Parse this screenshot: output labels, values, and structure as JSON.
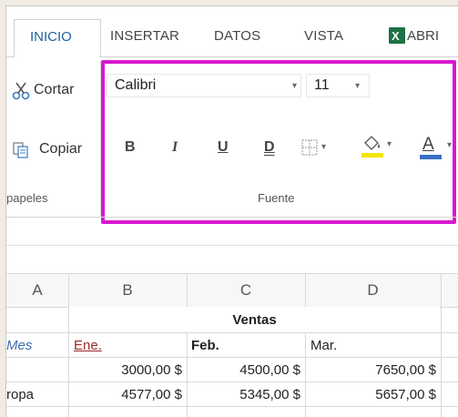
{
  "tabs": {
    "inicio": "INICIO",
    "insertar": "INSERTAR",
    "datos": "DATOS",
    "vista": "VISTA",
    "abrir": "ABRI"
  },
  "clipboard": {
    "cortar": "Cortar",
    "copiar": "Copiar",
    "group_label": "papeles"
  },
  "font_group": {
    "font_name": "Calibri",
    "font_size": "11",
    "bold": "B",
    "italic": "I",
    "underline": "U",
    "double_underline": "D",
    "font_color": "A",
    "group_label": "Fuente",
    "highlight_color": "#d619d0",
    "fill_color": "#f2e600",
    "font_color_bar": "#3a6fc8"
  },
  "sheet": {
    "columns": [
      "A",
      "B",
      "C",
      "D"
    ],
    "title": "Ventas",
    "row_mes": {
      "a": "Mes",
      "b": "Ene.",
      "c": "Feb.",
      "d": "Mar."
    },
    "row_1": {
      "a": "",
      "b": "3000,00 $",
      "c": "4500,00 $",
      "d": "7650,00 $"
    },
    "row_2": {
      "a": "ropa",
      "b": "4577,00 $",
      "c": "5345,00 $",
      "d": "5657,00 $"
    }
  }
}
